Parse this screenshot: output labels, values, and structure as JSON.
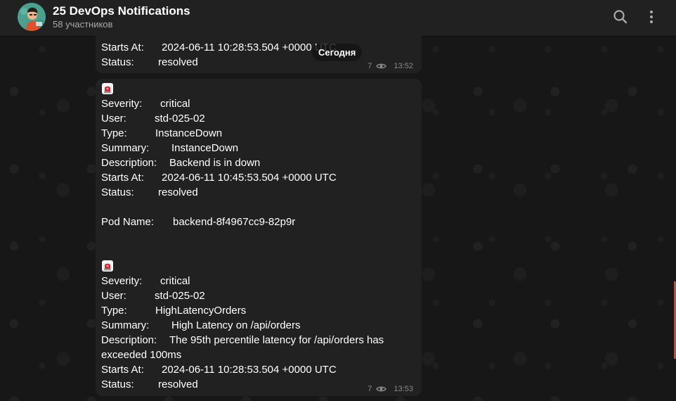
{
  "header": {
    "title": "25 DevOps Notifications",
    "subtitle": "58 участников"
  },
  "date_separator": "Сегодня",
  "messages": [
    {
      "lines": [
        {
          "label": "Starts At:",
          "value": "2024-06-11 10:28:53.504 +0000 UTC"
        },
        {
          "label": "Status:",
          "value": "resolved"
        }
      ],
      "views": "7",
      "time": "13:52"
    },
    {
      "alerts": [
        {
          "severity_label": "Severity:",
          "severity": "critical",
          "user_label": "User:",
          "user": "std-025-02",
          "type_label": "Type:",
          "type": "InstanceDown",
          "summary_label": "Summary:",
          "summary": "InstanceDown",
          "description_label": "Description:",
          "description": "Backend is in down",
          "starts_label": "Starts At:",
          "starts": "2024-06-11 10:45:53.504 +0000 UTC",
          "status_label": "Status:",
          "status": "resolved",
          "pod_label": "Pod Name:",
          "pod": "backend-8f4967cc9-82p9r"
        },
        {
          "severity_label": "Severity:",
          "severity": "critical",
          "user_label": "User:",
          "user": "std-025-02",
          "type_label": "Type:",
          "type": "HighLatencyOrders",
          "summary_label": "Summary:",
          "summary": "High Latency on /api/orders",
          "description_label": "Description:",
          "description": "The 95th percentile latency for /api/orders has",
          "description_cont": "exceeded 100ms",
          "starts_label": "Starts At:",
          "starts": "2024-06-11 10:28:53.504 +0000 UTC",
          "status_label": "Status:",
          "status": "resolved"
        }
      ],
      "views": "7",
      "time": "13:53"
    }
  ],
  "icons": {
    "siren": "police-car-light-icon",
    "views": "eye-icon",
    "search": "search-icon",
    "menu": "more-vertical-icon"
  },
  "colors": {
    "background": "#171717",
    "header": "#212121",
    "bubble": "#212121",
    "meta_text": "#8a8a8a",
    "siren_red": "#e8212e"
  }
}
